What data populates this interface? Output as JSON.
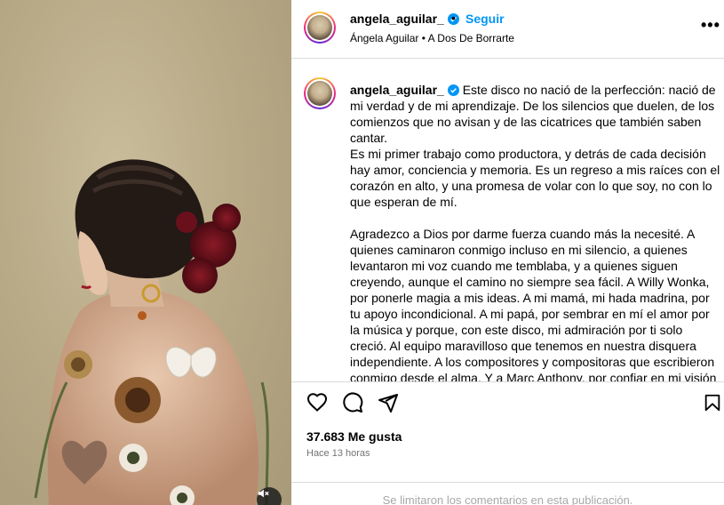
{
  "post": {
    "username": "angela_aguilar_",
    "separator": "•",
    "follow_label": "Seguir",
    "subtitle": "Ángela Aguilar • A Dos De Borrarte",
    "more_label": "•••"
  },
  "caption": {
    "username": "angela_aguilar_",
    "paragraph_1": "Este disco no nació de la perfección: nació de mi verdad y de mi aprendizaje. De los silencios que duelen, de los comienzos que no avisan y de las cicatrices que también saben cantar.",
    "paragraph_2": "Es mi primer trabajo como productora, y detrás de cada decisión hay amor, conciencia y memoria. Es un regreso a mis raíces con el corazón en alto, y una promesa de volar con lo que soy, no con lo que esperan de mí.",
    "paragraph_3": "Agradezco a Dios por darme fuerza cuando más la necesité. A quienes caminaron conmigo incluso en mi silencio, a quienes levantaron mi voz cuando me temblaba, y a quienes siguen creyendo, aunque el camino no siempre sea fácil. A Willy Wonka, por ponerle magia a mis ideas. A mi mamá, mi hada madrina, por tu apoyo incondicional. A mi papá, por sembrar en mí el amor por la música y porque, con este disco, mi admiración por ti solo creció. Al equipo maravilloso que tenemos en nuestra disquera independiente. A los compositores y compositoras que escribieron conmigo desde el alma. Y a Marc Anthony, por confiar en mi visión"
  },
  "actions": {
    "like_icon": "heart-icon",
    "comment_icon": "comment-icon",
    "share_icon": "send-icon",
    "save_icon": "bookmark-icon"
  },
  "stats": {
    "likes": "37.683 Me gusta",
    "time": "Hace 13 horas"
  },
  "comments_note": "Se limitaron los comentarios en esta publicación.",
  "media": {
    "mute_icon": "speaker-muted-icon"
  },
  "colors": {
    "accent": "#0095f6",
    "verified": "#0095f6",
    "muted_text": "#737373",
    "divider": "#dbdbdb"
  }
}
